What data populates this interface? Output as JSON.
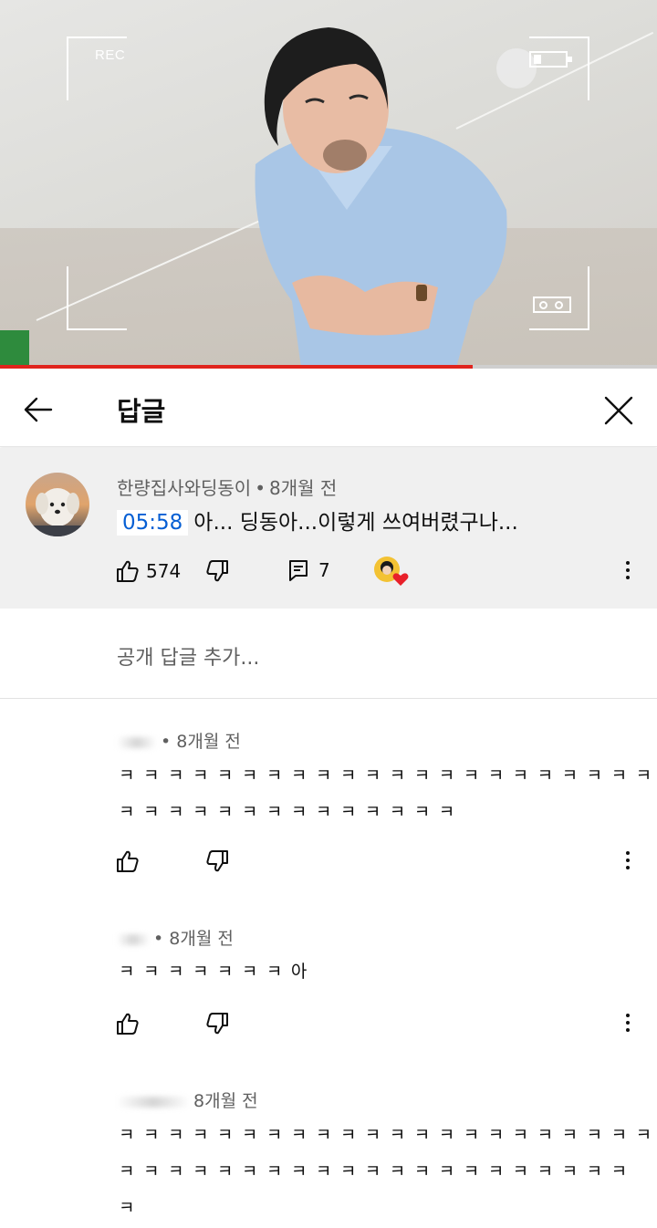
{
  "video": {
    "rec_label": "REC",
    "progress_fraction": 0.72
  },
  "header": {
    "title": "답글"
  },
  "parent_comment": {
    "author": "한량집사와딩동이",
    "time": "8개월 전",
    "timestamp_link": "05:58",
    "text": "아... 딩동아...이렇게 쓰여버렸구나...",
    "like_count": "574",
    "reply_count": "7"
  },
  "add_reply": {
    "placeholder": "공개 답글 추가..."
  },
  "replies": [
    {
      "time": "8개월 전",
      "lines": [
        "ㅋㅋㅋㅋㅋㅋㅋㅋㅋㅋㅋㅋㅋㅋㅋㅋㅋㅋㅋㅋㅋㅋ",
        "ㅋㅋㅋㅋㅋㅋㅋㅋㅋㅋㅋㅋㅋㅋ"
      ]
    },
    {
      "time": "8개월 전",
      "lines": [
        "ㅋㅋㅋㅋㅋㅋㅋ아"
      ]
    },
    {
      "time": "8개월 전",
      "lines": [
        "ㅋㅋㅋㅋㅋㅋㅋㅋㅋㅋㅋㅋㅋㅋㅋㅋㅋㅋㅋㅋㅋㅋ",
        "ㅋㅋㅋㅋㅋㅋㅋㅋㅋㅋㅋㅋㅋㅋㅋㅋㅋㅋㅋㅋㅋ",
        "ㅋ"
      ]
    }
  ],
  "colors": {
    "progress_red": "#e0241d",
    "timestamp_blue": "#065fd4",
    "parent_bg": "#f0f0f0",
    "heart_red": "#e8202a"
  },
  "icons": [
    "back-arrow-icon",
    "close-icon",
    "thumbs-up-icon",
    "thumbs-down-icon",
    "reply-icon",
    "creator-heart-icon",
    "more-vert-icon",
    "battery-icon",
    "tape-icon"
  ]
}
